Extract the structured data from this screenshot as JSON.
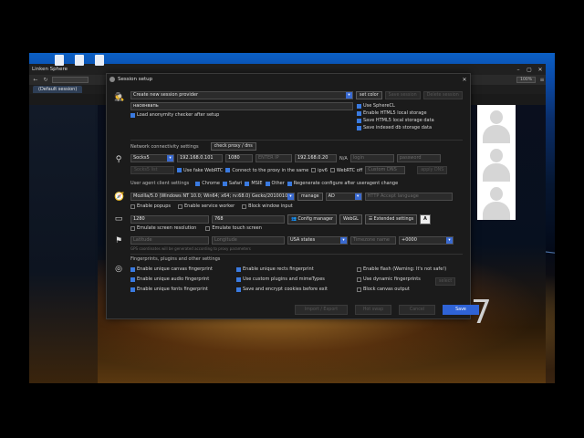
{
  "browser": {
    "title": "Linken Sphere",
    "tab": "(Default session)",
    "zoom_label": "100%"
  },
  "dialog": {
    "title": "Session setup",
    "provider": {
      "select_value": "Create new session provider",
      "set_color": "set color",
      "btn_disabled_1": "Save session",
      "btn_disabled_2": "Delete session",
      "name_value": "насенвапь",
      "load_checker": "Load anonymity checker after setup",
      "use_spherecl": "Use SphereCL",
      "enable_html5": "Enable HTML5 local storage",
      "save_html5": "Save HTML5 local storage data",
      "save_indexeddb": "Save indexed db storage data"
    },
    "network": {
      "section_label": "Network connectivity settings",
      "check_button": "check proxy / dns",
      "protocol": "Socks5",
      "ip": "192.168.0.101",
      "port": "1080",
      "ip_placeholder": "ENTER IP",
      "local_ip": "192.168.0.20",
      "na_label": "N/A",
      "login_placeholder": "login",
      "password_placeholder": "password",
      "btn_disabled": "Socks5 list",
      "use_fake_webrtc": "Use fake WebRTC",
      "connect_proxy": "Connect to the proxy in the same",
      "ipv6": "ipv6",
      "webrtc_off": "WebRTC off",
      "custom_dns": "Custom DNS",
      "apply_btn": "apply DNS"
    },
    "useragent": {
      "section_label": "User agent client settings",
      "chrome": "Chrome",
      "safari": "Safari",
      "msie": "MSIE",
      "other": "Other",
      "regenerate": "Regenerate configure after useragent change",
      "ua_value": "Mozilla/5.0 (Windows NT 10.0; Win64; x64; rv:68.0) Gecko/20100101",
      "manage_btn": "manage",
      "lang_value": "AD",
      "accept_lang_placeholder": "HTTP Accept language",
      "enable_popups": "Enable popups",
      "enable_service_worker": "Enable service worker",
      "block_window_input": "Block window input"
    },
    "screen": {
      "width": "1280",
      "height": "768",
      "config_manager": "Config manager",
      "webgl_label": "WebGL",
      "extended_settings": "Extended settings",
      "font_button": "A",
      "emulate_resolution": "Emulate screen resolution",
      "emulate_touch": "Emulate touch screen"
    },
    "geo": {
      "latitude_placeholder": "Latitude",
      "longitude_placeholder": "Longitude",
      "state_value": "USA states",
      "timezone_placeholder": "Timezone name",
      "offset_value": "+0000",
      "hint": "GPS coordinates will be generated according to proxy parameters"
    },
    "fingerprints": {
      "section_label": "Fingerprints, plugins and other settings",
      "items": [
        {
          "label": "Enable unique canvas fingerprint",
          "checked": true
        },
        {
          "label": "Enable unique audio fingerprint",
          "checked": true
        },
        {
          "label": "Enable unique fonts fingerprint",
          "checked": true
        },
        {
          "label": "Enable unique rects fingerprint",
          "checked": true
        },
        {
          "label": "Use custom plugins and mimeTypes",
          "checked": true
        },
        {
          "label": "Save and encrypt cookies before exit",
          "checked": true
        },
        {
          "label": "Enable flash (Warning: It's not safe!)",
          "checked": false
        },
        {
          "label": "Use dynamic fingerprints",
          "checked": false
        },
        {
          "label": "Block canvas output",
          "checked": false
        }
      ],
      "side_button": "select"
    },
    "footer": {
      "btn_1": "Import / Export",
      "btn_2": "Hot swap",
      "btn_3": "Cancel",
      "save": "Save"
    }
  },
  "overlay_number": "7",
  "colors": {
    "accent": "#2f63d6",
    "dialog_bg": "#1b1b1b"
  }
}
